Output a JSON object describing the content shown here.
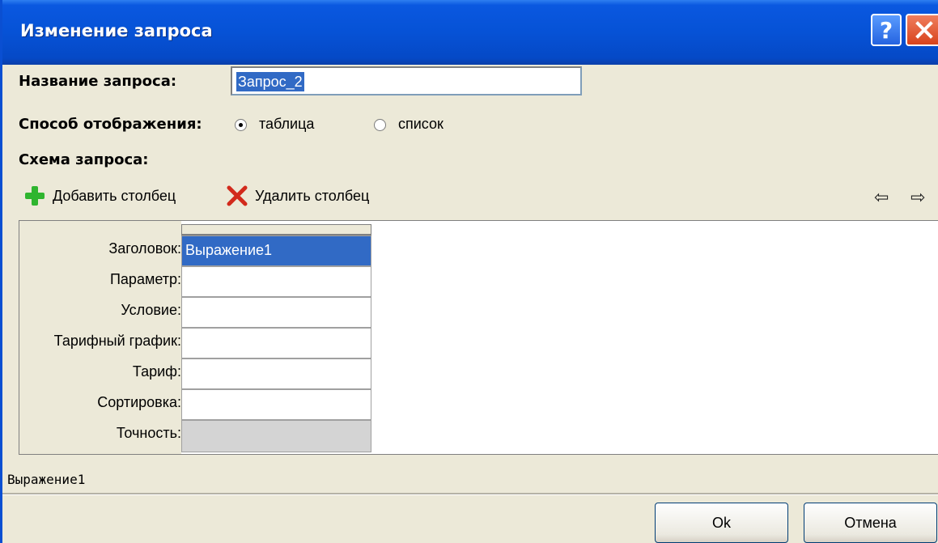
{
  "window": {
    "title": "Изменение запроса"
  },
  "form": {
    "name_label": "Название запроса:",
    "name_value": "Запрос_2",
    "display_label": "Способ отображения:",
    "display_options": [
      {
        "label": "таблица",
        "selected": true
      },
      {
        "label": "список",
        "selected": false
      }
    ],
    "schema_label": "Схема запроса:"
  },
  "toolbar": {
    "add_column": "Добавить столбец",
    "delete_column": "Удалить столбец",
    "left_arrow": "⇦",
    "right_arrow": "⇨"
  },
  "grid": {
    "row_labels": [
      "Заголовок:",
      "Параметр:",
      "Условие:",
      "Тарифный график:",
      "Тариф:",
      "Сортировка:",
      "Точность:"
    ],
    "column_values": [
      "Выражение1",
      "",
      "",
      "",
      "",
      "",
      ""
    ]
  },
  "status_text": "Выражение1",
  "buttons": {
    "ok": "Ok",
    "cancel": "Отмена"
  },
  "icons": {
    "help": "help-icon",
    "close": "close-icon",
    "add": "plus-icon",
    "delete": "delete-x-icon"
  },
  "colors": {
    "titlebar": "#0652d6",
    "selection": "#316ac5"
  }
}
